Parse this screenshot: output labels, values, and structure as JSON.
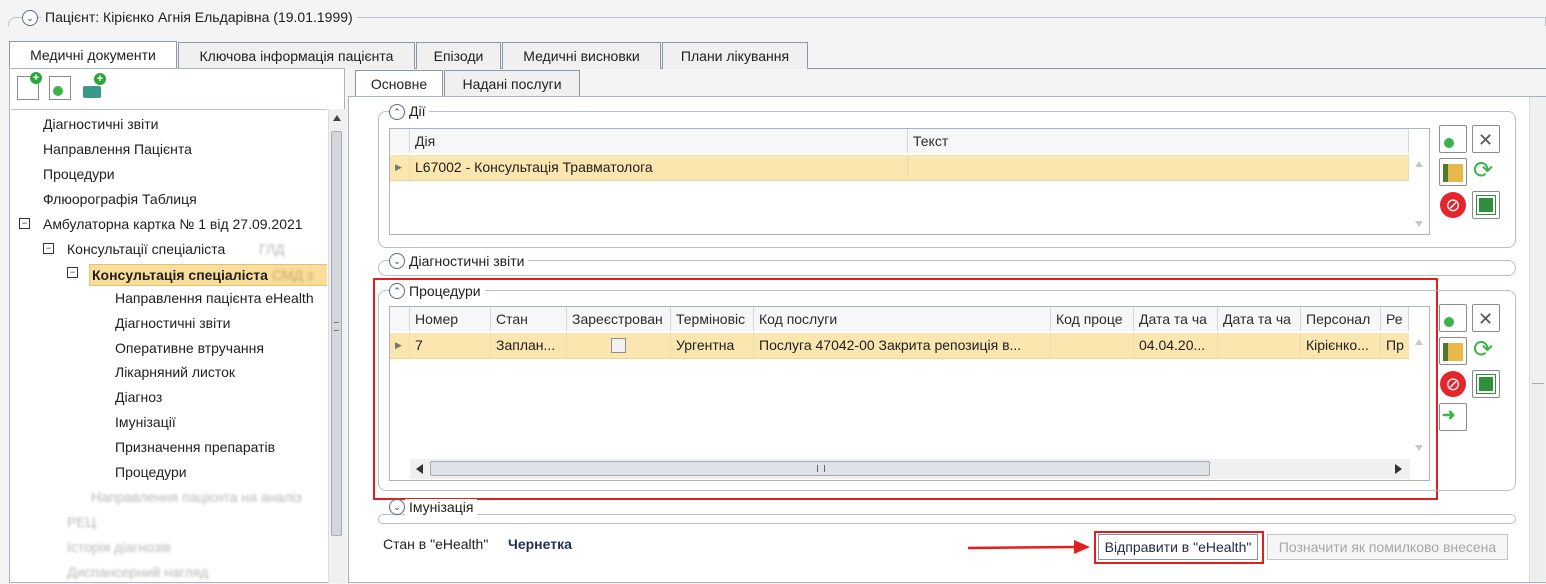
{
  "patient_header": {
    "title": "Пацієнт: Кірієнко Агнія Ельдарівна (19.01.1999)"
  },
  "main_tabs": [
    "Медичні документи",
    "Ключова інформація пацієнта",
    "Епізоди",
    "Медичні висновки",
    "Плани лікування"
  ],
  "sub_tabs": [
    "Основне",
    "Надані послуги"
  ],
  "tree": {
    "items": [
      "Діагностичні звіти",
      "Направлення Пацієнта",
      "Процедури",
      "Флюорографія Таблиця",
      "Амбулаторна картка № 1 від 27.09.2021",
      "Консультації спеціаліста",
      "Консультація спеціаліста",
      "Направлення пацієнта eHealth",
      "Діагностичні звіти",
      "Оперативне втручання",
      "Лікарняний листок",
      "Діагноз",
      "Імунізації",
      "Призначення препаратів",
      "Процедури"
    ],
    "blurred": [
      "Направлення пацієнта на аналіз",
      "РЕЦ",
      "Історія діагнозів",
      "Диспансерний нагляд"
    ]
  },
  "actions": {
    "title": "Дії",
    "columns": [
      "Дія",
      "Текст"
    ],
    "rows": [
      {
        "action": "L67002 - Консультація Травматолога",
        "text": ""
      }
    ]
  },
  "diagnostic_reports": {
    "title": "Діагностичні звіти"
  },
  "procedures": {
    "title": "Процедури",
    "columns": [
      "Номер",
      "Стан",
      "Зареєстрован",
      "Терміновіс",
      "Код послуги",
      "Код проце",
      "Дата та ча",
      "Дата та ча",
      "Персонал",
      "Ре"
    ],
    "rows": [
      {
        "number": "7",
        "state": "Заплан...",
        "registered": false,
        "urgency": "Ургентна",
        "service_code": "Послуга 47042-00 Закрита репозиція в...",
        "procedure_code": "",
        "date1": "04.04.20...",
        "date2": "",
        "staff": "Кірієнко...",
        "re": "Пр"
      }
    ]
  },
  "immunization": {
    "title": "Імунізація"
  },
  "ehealth": {
    "status_label": "Стан в \"eHealth\"",
    "status_value": "Чернетка",
    "send_button": "Відправити в \"eHealth\"",
    "mark_error_button": "Позначити як помилково внесена"
  },
  "colors": {
    "row_highlight": "#fbe6b0",
    "annotation": "#e02020",
    "selected_node": "#f9dd9a"
  }
}
